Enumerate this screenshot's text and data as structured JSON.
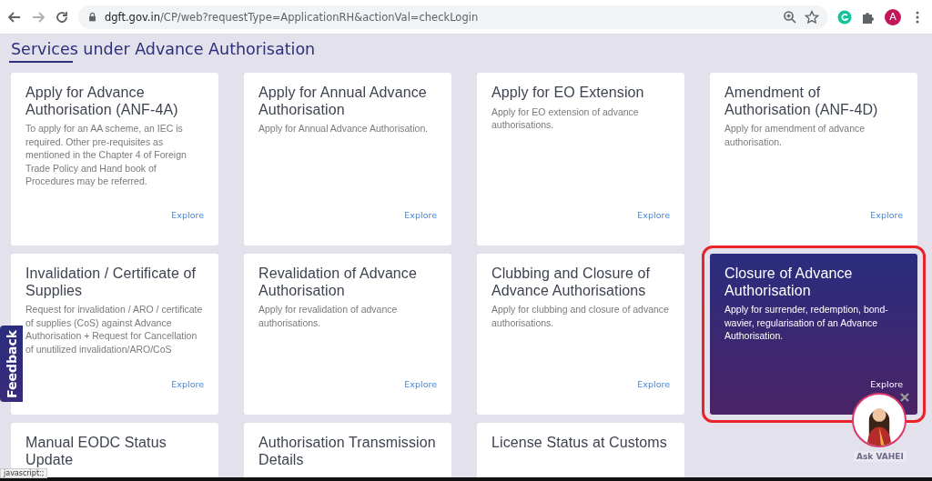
{
  "browser": {
    "url_domain": "dgft.gov.in",
    "url_path": "/CP/web?requestType=ApplicationRH&actionVal=checkLogin",
    "profile_initial": "A"
  },
  "page": {
    "heading": "Services under Advance Authorisation",
    "cards": [
      {
        "title": "Apply for Advance Authorisation (ANF-4A)",
        "description": "To apply for an AA scheme, an IEC is required. Other pre-requisites as mentioned in the Chapter 4 of Foreign Trade Policy and Hand book of Procedures may be referred.",
        "link": "Explore",
        "highlighted": false
      },
      {
        "title": "Apply for Annual Advance Authorisation",
        "description": "Apply for Annual Advance Authorisation.",
        "link": "Explore",
        "highlighted": false
      },
      {
        "title": "Apply for EO Extension",
        "description": "Apply for EO extension of advance authorisations.",
        "link": "Explore",
        "highlighted": false
      },
      {
        "title": "Amendment of Authorisation (ANF-4D)",
        "description": "Apply for amendment of advance authorisation.",
        "link": "Explore",
        "highlighted": false
      },
      {
        "title": "Invalidation / Certificate of Supplies",
        "description": "Request for invalidation / ARO / certificate of supplies (CoS) against Advance Authorisation + Request for Cancellation of unutilized invalidation/ARO/CoS",
        "link": "Explore",
        "highlighted": false
      },
      {
        "title": "Revalidation of Advance Authorisation",
        "description": "Apply for revalidation of advance authorisations.",
        "link": "Explore",
        "highlighted": false
      },
      {
        "title": "Clubbing and Closure of Advance Authorisations",
        "description": "Apply for clubbing and closure of advance authorisations.",
        "link": "Explore",
        "highlighted": false
      },
      {
        "title": "Closure of Advance Authorisation",
        "description": "Apply for surrender, redemption, bond-wavier, regularisation of an Advance Authorisation.",
        "link": "Explore",
        "highlighted": true
      },
      {
        "title": "Manual EODC Status Update",
        "highlighted": false
      },
      {
        "title": "Authorisation Transmission Details",
        "highlighted": false
      },
      {
        "title": "License Status at Customs",
        "highlighted": false
      }
    ],
    "feedback_tab": "Feedback",
    "chatbot": {
      "label": "Ask VAHEI"
    }
  },
  "status_bar": "javascript:;"
}
